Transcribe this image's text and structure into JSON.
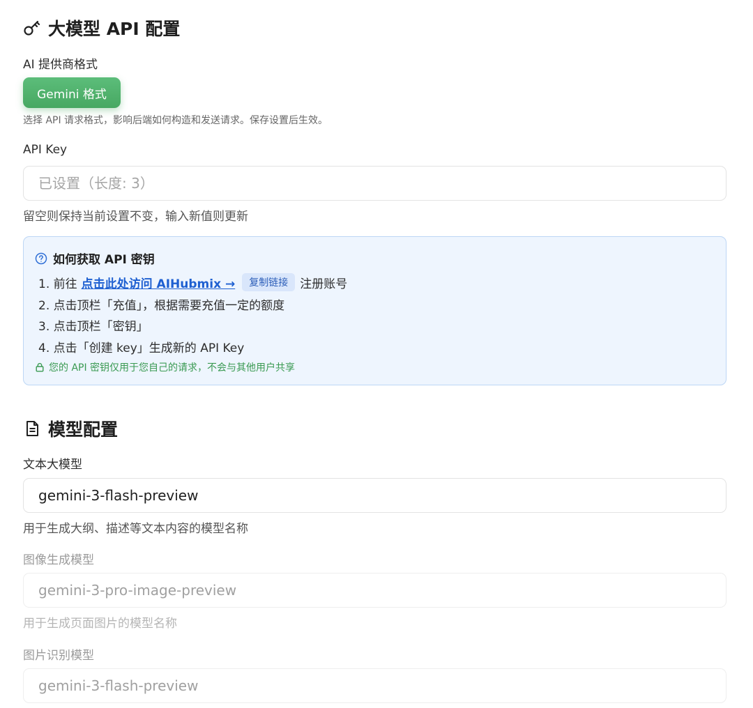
{
  "api_section": {
    "title": "大模型 API 配置",
    "title_icon": "key-icon",
    "provider_label": "AI 提供商格式",
    "provider_button": "Gemini 格式",
    "provider_help": "选择 API 请求格式，影响后端如何构造和发送请求。保存设置后生效。",
    "api_key_label": "API Key",
    "api_key_placeholder": "已设置（长度: 3）",
    "api_key_help": "留空则保持当前设置不变，输入新值则更新"
  },
  "info_box": {
    "title": "如何获取 API 密钥",
    "title_icon": "help-circle-icon",
    "step1_prefix": "1. 前往",
    "step1_link": "点击此处访问 AIHubmix →",
    "step1_copy": "复制链接",
    "step1_suffix": "注册账号",
    "step2": "2. 点击顶栏「充值」，根据需要充值一定的额度",
    "step3": "3. 点击顶栏「密钥」",
    "step4": "4. 点击「创建 key」生成新的 API Key",
    "secure_note": "您的 API 密钥仅用于您自己的请求，不会与其他用户共享",
    "secure_icon": "lock-icon"
  },
  "model_section": {
    "title": "模型配置",
    "title_icon": "document-icon",
    "text_model_label": "文本大模型",
    "text_model_value": "gemini-3-flash-preview",
    "text_model_help": "用于生成大纲、描述等文本内容的模型名称",
    "image_model_label": "图像生成模型",
    "image_model_value": "gemini-3-pro-image-preview",
    "image_model_help": "用于生成页面图片的模型名称",
    "vision_model_label": "图片识别模型",
    "vision_model_value": "gemini-3-flash-preview"
  },
  "colors": {
    "accent_green": "#4caf68",
    "link_blue": "#1d5fd1",
    "info_bg": "#eef5fe",
    "info_border": "#bcd6f5"
  }
}
